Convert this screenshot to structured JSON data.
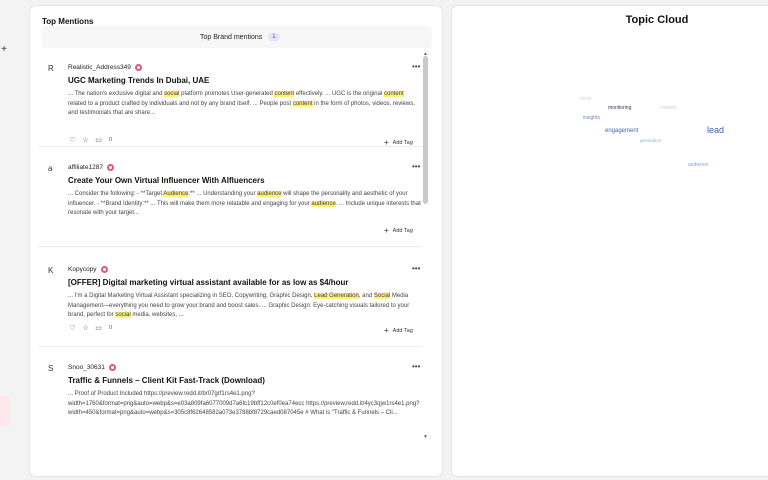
{
  "mentions": {
    "title": "Top Mentions",
    "tab_label": "Top Brand mentions",
    "tab_count": "1",
    "posts": [
      {
        "avatar": "R",
        "user": "Realistic_Address349",
        "title": "UGC Marketing Trends In Dubai, UAE",
        "body": [
          {
            "t": "... The nation's exclusive digital and "
          },
          {
            "t": "social",
            "h": true
          },
          {
            "t": " platform promotes User-generated "
          },
          {
            "t": "content",
            "h": true
          },
          {
            "t": " effectively. ... UGC is the original "
          },
          {
            "t": "content",
            "h": true
          },
          {
            "t": " related to a product crafted by individuals and not by any brand itself. ... People post "
          },
          {
            "t": "content",
            "h": true
          },
          {
            "t": " in the form of photos, videos, reviews, and testimonials that are share..."
          }
        ],
        "count": "0",
        "add_tag": "Add Tag"
      },
      {
        "avatar": "a",
        "user": "affiliate1287",
        "title": "Create Your Own Virtual Influencer With AIfluencers",
        "body": [
          {
            "t": "... Consider the following: - **Target "
          },
          {
            "t": "Audience",
            "h": true
          },
          {
            "t": ":** ... Understanding your "
          },
          {
            "t": "audience",
            "h": true
          },
          {
            "t": " will shape the personality and aesthetic of your influencer. - **Brand Identity:** ... This will make them more relatable and engaging for your "
          },
          {
            "t": "audience",
            "h": true
          },
          {
            "t": ". ... Include unique interests that resonate with your target..."
          }
        ],
        "count": "",
        "add_tag": "Add Tag"
      },
      {
        "avatar": "K",
        "user": "Kopycopy",
        "title": "[OFFER] Digital marketing virtual assistant available for as low as $4/hour",
        "body": [
          {
            "t": "... I'm a Digital Marketing Virtual Assistant specializing in SEO, Copywriting, Graphic Design, "
          },
          {
            "t": "Lead Generation",
            "h": true
          },
          {
            "t": ", and "
          },
          {
            "t": "Social",
            "h": true
          },
          {
            "t": " Media Management—everything you need to grow your brand and boost sales. ... Graphic Design: Eye-catching visuals tailored to your brand, perfect for "
          },
          {
            "t": "social",
            "h": true
          },
          {
            "t": " media, websites, ..."
          }
        ],
        "count": "0",
        "add_tag": "Add Tag"
      },
      {
        "avatar": "S",
        "user": "Snoo_30631",
        "title": "Traffic & Funnels – Client Kit Fast-Track (Download)",
        "body": [
          {
            "t": "... Proof of Product Included https://preview.redd.it/br07grf1rs4e1.png?width=1760&format=png&auto=webp&s=e03a809fa6077009d7a6fc19bff12c0ef0ea74ecc https://preview.redd.it/4yc3qjw1rs4e1.png?width=450&format=png&auto=webp&s=305c8f62648582a073e3788bf8729caed087045e # What is \"Traffic & Funnels – Cli..."
          }
        ],
        "count": "",
        "add_tag": ""
      }
    ]
  },
  "topic_cloud": {
    "title": "Topic Cloud",
    "words": [
      {
        "text": "tiktok",
        "color": "#cfd6e6"
      },
      {
        "text": "monitoring",
        "color": "#2f3a55"
      },
      {
        "text": "content",
        "color": "#c7d0e4"
      },
      {
        "text": "insights",
        "color": "#6d86c2"
      },
      {
        "text": "lead",
        "color": "#3a5db0"
      },
      {
        "text": "engagement",
        "color": "#3f63b8"
      },
      {
        "text": "generation",
        "color": "#9aa9cf"
      },
      {
        "text": "audience",
        "color": "#8fa2d6"
      }
    ]
  }
}
